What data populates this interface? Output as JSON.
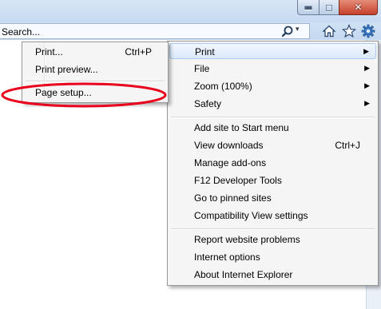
{
  "window": {
    "min_glyph": "▬",
    "max_glyph": "◻",
    "close_glyph": "✕"
  },
  "search": {
    "placeholder": "Search...",
    "dropdown_glyph": "▾"
  },
  "toolbar": {
    "home_icon": "home-icon",
    "favorites_icon": "star-icon",
    "tools_icon": "gear-icon"
  },
  "print_submenu": [
    {
      "label": "Print...",
      "shortcut": "Ctrl+P"
    },
    {
      "label": "Print preview...",
      "shortcut": ""
    },
    {
      "label": "Page setup...",
      "shortcut": "",
      "circled": true
    }
  ],
  "tools_menu": {
    "group1": [
      {
        "label": "Print",
        "arrow": "▶",
        "highlighted": true
      },
      {
        "label": "File",
        "arrow": "▶"
      },
      {
        "label": "Zoom (100%)",
        "arrow": "▶"
      },
      {
        "label": "Safety",
        "arrow": "▶"
      }
    ],
    "group2": [
      {
        "label": "Add site to Start menu",
        "shortcut": ""
      },
      {
        "label": "View downloads",
        "shortcut": "Ctrl+J"
      },
      {
        "label": "Manage add-ons",
        "shortcut": ""
      },
      {
        "label": "F12 Developer Tools",
        "shortcut": ""
      },
      {
        "label": "Go to pinned sites",
        "shortcut": ""
      },
      {
        "label": "Compatibility View settings",
        "shortcut": ""
      }
    ],
    "group3": [
      {
        "label": "Report website problems"
      },
      {
        "label": "Internet options"
      },
      {
        "label": "About Internet Explorer"
      }
    ]
  },
  "colors": {
    "highlight_border": "#a8c9ee",
    "annotation_red": "#e8001c"
  }
}
